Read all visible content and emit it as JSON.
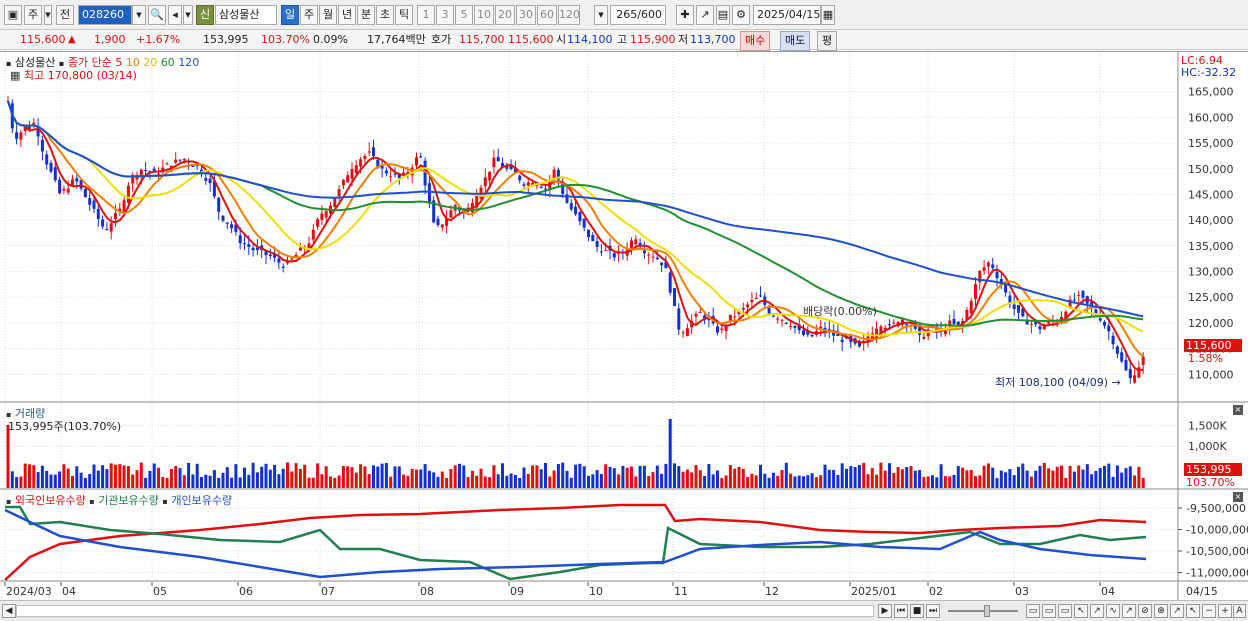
{
  "toolbar": {
    "period_label": "주",
    "prev_label": "전",
    "code": "028260",
    "sin_label": "신",
    "stock_name": "삼성물산",
    "day_label": "일",
    "week_label": "주",
    "month_label": "월",
    "year_label": "년",
    "minute_label": "분",
    "second_label": "초",
    "tick_label": "틱",
    "interval_options": [
      "1",
      "3",
      "5",
      "10",
      "20",
      "30",
      "60",
      "120"
    ],
    "count_value": "265",
    "count_total": "/600",
    "date_value": "2025/04/15"
  },
  "quote": {
    "price": "115,600",
    "change": "1,900",
    "change_pct": "+1.67%",
    "volume": "153,995",
    "volume_ratio": "103.70%",
    "turnover_pct": "0.09%",
    "amount": "17,764백만",
    "hoga_label": "호가",
    "hoga_ask": "115,700",
    "hoga_bid": "115,600",
    "open_label": "시",
    "open": "114,100",
    "high_label": "고",
    "high": "115,900",
    "low_label": "저",
    "low": "113,700",
    "buy_label": "매수",
    "sell_label": "매도",
    "eval_label": "평"
  },
  "price_panel": {
    "legend_name": "삼성물산",
    "legend_ma": "종가 단순",
    "ma_periods": [
      "5",
      "10",
      "20",
      "60",
      "120"
    ],
    "ma_colors": [
      "#e01010",
      "#f08000",
      "#f0e000",
      "#209030",
      "#2050d0"
    ],
    "high_note": "최고 170,800 (03/14)",
    "low_note": "최저 108,100 (04/09)",
    "dividend_note": "배당락(0.00%)",
    "lc_label": "LC:6.94",
    "hc_label": "HC:-32.32",
    "last_price_tag": "115,600",
    "last_pct_tag": "1.58%",
    "y_ticks": [
      "165,000",
      "160,000",
      "155,000",
      "150,000",
      "145,000",
      "140,000",
      "135,000",
      "130,000",
      "125,000",
      "120,000",
      "115,000",
      "110,000"
    ]
  },
  "volume_panel": {
    "title": "거래량",
    "value_note": "153,995주(103.70%)",
    "y_ticks": [
      "1,500K",
      "1,000K"
    ],
    "last_tag": "153,995",
    "last_pct": "103.70%"
  },
  "holding_panel": {
    "series": [
      {
        "name": "외국인보유수량",
        "color": "#e01010"
      },
      {
        "name": "기관보유수량",
        "color": "#208050"
      },
      {
        "name": "개인보유수량",
        "color": "#2050d0"
      }
    ],
    "y_ticks": [
      "-9,500,000",
      "-10,000,000",
      "-10,500,000",
      "-11,000,000"
    ]
  },
  "x_axis": {
    "labels": [
      "2024/03",
      "04",
      "05",
      "06",
      "07",
      "08",
      "09",
      "10",
      "11",
      "12",
      "2025/01",
      "02",
      "03",
      "04"
    ],
    "right_label": "04/15"
  },
  "chart_data": {
    "type": "candlestick",
    "y_range": [
      105000,
      170000
    ],
    "high": {
      "value": 170800,
      "date": "03/14"
    },
    "low": {
      "value": 108100,
      "date": "04/09"
    },
    "last_close": 115600
  }
}
